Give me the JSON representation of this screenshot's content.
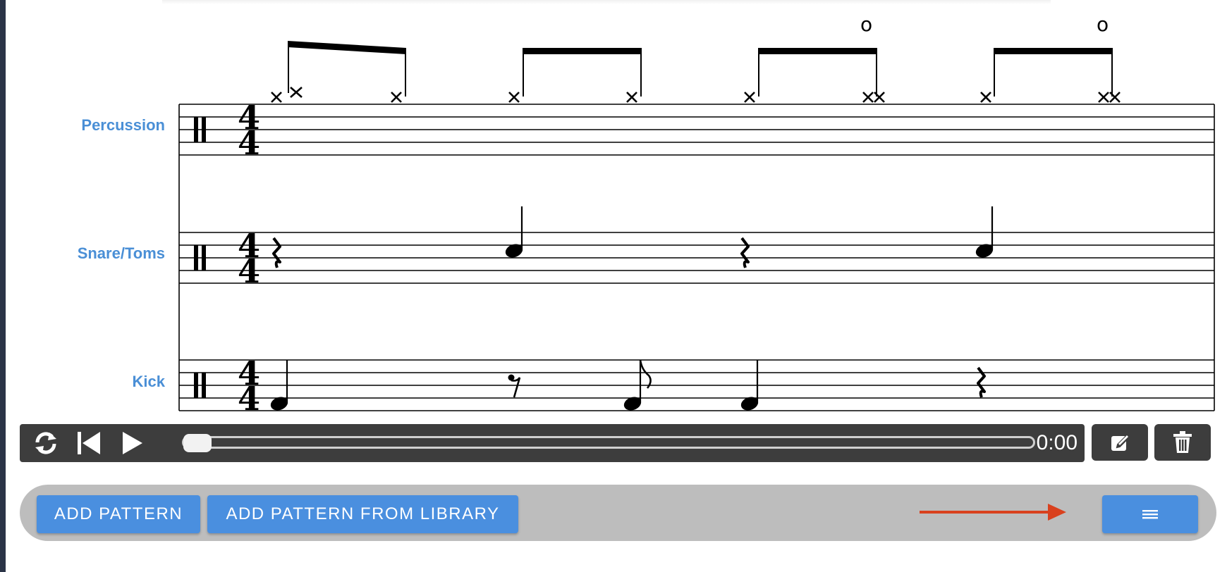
{
  "staves": [
    {
      "label": "Percussion"
    },
    {
      "label": "Snare/Toms"
    },
    {
      "label": "Kick"
    }
  ],
  "score": {
    "time_signature": {
      "top": "4",
      "bottom": "4"
    },
    "open_hihat_marks": [
      "o",
      "o"
    ]
  },
  "player": {
    "loop_icon": "loop-icon",
    "rewind_icon": "skip-back-icon",
    "play_icon": "play-icon",
    "time": "0:00",
    "progress": 0
  },
  "actions": {
    "edit_icon": "edit-icon",
    "delete_icon": "trash-icon"
  },
  "toolbar": {
    "add_pattern_label": "ADD PATTERN",
    "add_from_library_label": "ADD PATTERN FROM LIBRARY",
    "menu_icon": "menu-icon"
  },
  "colors": {
    "accent": "#4a8fdf",
    "label": "#4a8fd6",
    "player_bg": "#3d3d3d",
    "annotation_arrow": "#d9411e"
  }
}
